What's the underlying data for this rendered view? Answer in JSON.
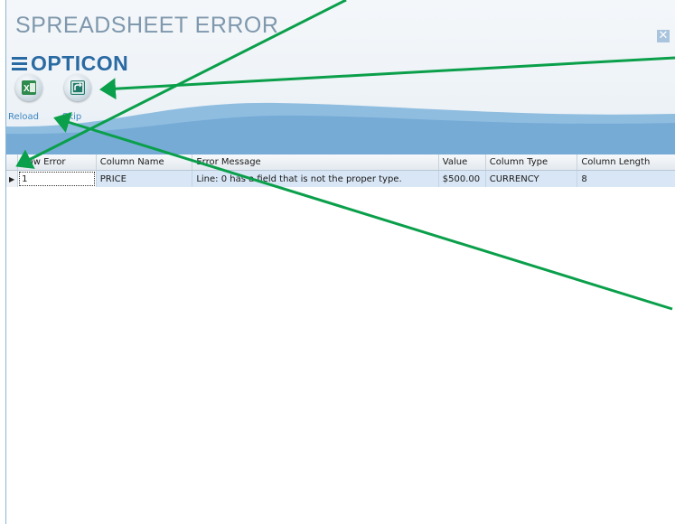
{
  "window": {
    "title": "SPREADSHEET ERROR",
    "close_icon": "close-icon"
  },
  "brand": {
    "name": "OPTICON",
    "color": "#2a6aa3"
  },
  "toolbar": {
    "reload_label": "Reload",
    "skip_label": "Skip",
    "reload_icon": "excel-icon",
    "skip_icon": "skip-icon"
  },
  "grid": {
    "columns": [
      "Row Error",
      "Column Name",
      "Error Message",
      "Value",
      "Column Type",
      "Column Length"
    ],
    "rows": [
      {
        "row_error": "1",
        "column_name": "PRICE",
        "error_message": "Line: 0 has a field that is not the proper type.",
        "value": "$500.00",
        "column_type": "CURRENCY",
        "column_length": "8"
      }
    ]
  },
  "annotation_color": "#0a9f4a"
}
